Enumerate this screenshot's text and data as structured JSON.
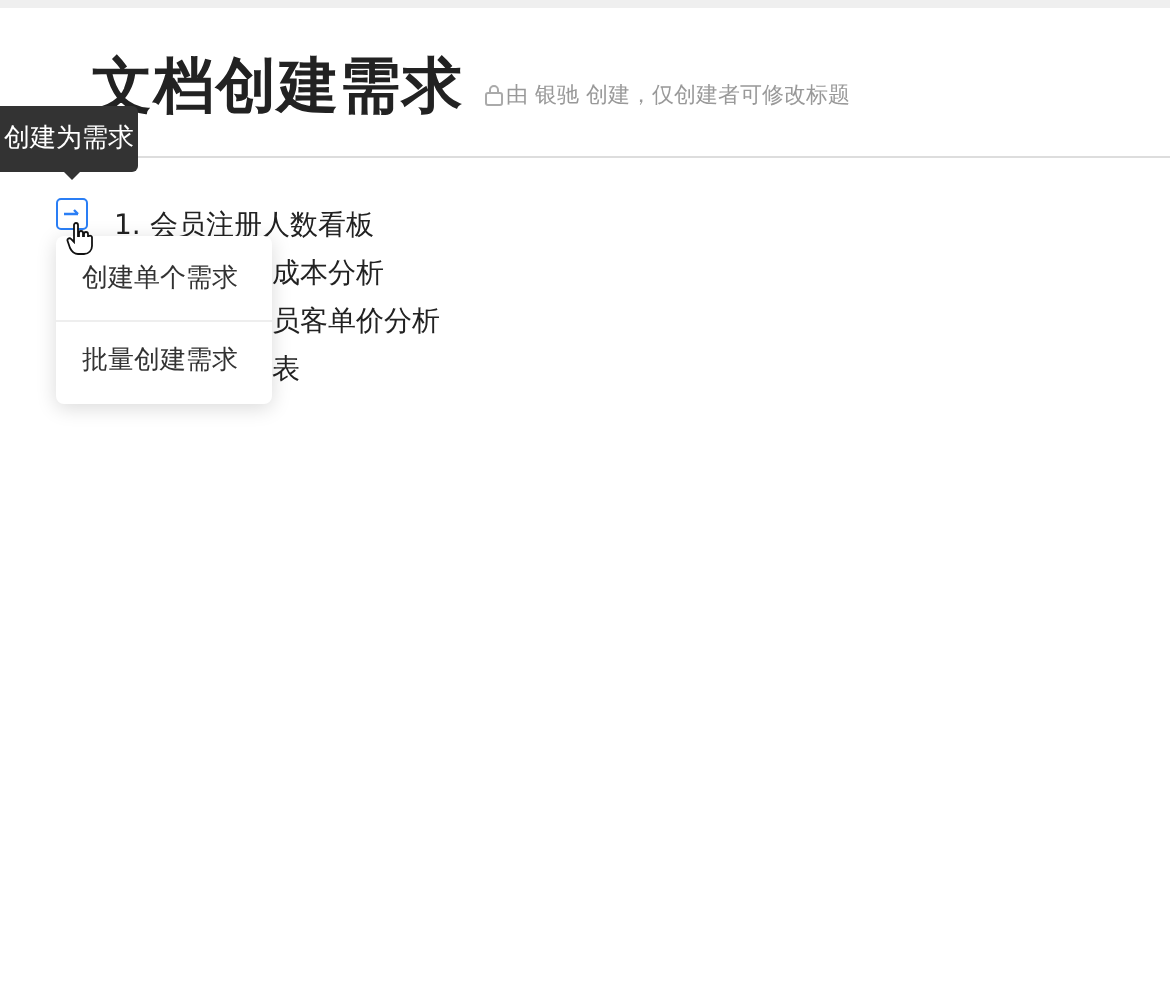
{
  "document": {
    "title": "文档创建需求",
    "permission_note": "由 银驰 创建，仅创建者可修改标题"
  },
  "tooltip": {
    "text": "创建为需求"
  },
  "list_items": [
    {
      "text": "1. 会员注册人数看板"
    },
    {
      "text": "成本分析"
    },
    {
      "text": "员客单价分析"
    },
    {
      "text": "表"
    }
  ],
  "menu": [
    {
      "label": "创建单个需求"
    },
    {
      "label": "批量创建需求"
    }
  ]
}
